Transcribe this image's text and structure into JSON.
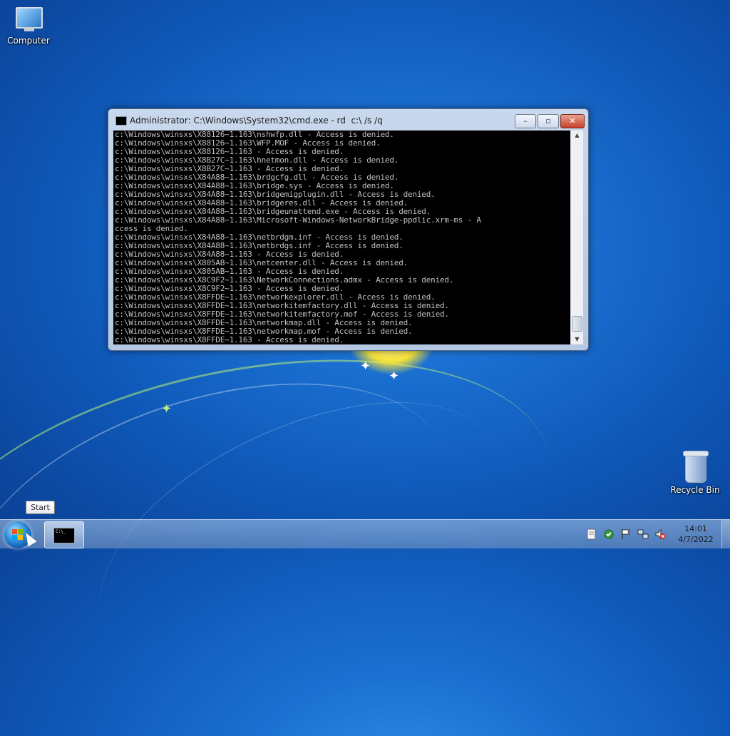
{
  "desktop": {
    "icons": [
      {
        "label": "Computer"
      },
      {
        "label": "Recycle Bin"
      }
    ]
  },
  "window": {
    "title": "Administrator: C:\\Windows\\System32\\cmd.exe - rd  c:\\ /s /q",
    "buttons": {
      "minimize": "–",
      "maximize": "▫",
      "close": "✕"
    },
    "console_lines": [
      "c:\\Windows\\winsxs\\X88126~1.163\\nshwfp.dll - Access is denied.",
      "c:\\Windows\\winsxs\\X88126~1.163\\WFP.MOF - Access is denied.",
      "c:\\Windows\\winsxs\\X88126~1.163 - Access is denied.",
      "c:\\Windows\\winsxs\\X8B27C~1.163\\hnetmon.dll - Access is denied.",
      "c:\\Windows\\winsxs\\X8B27C~1.163 - Access is denied.",
      "c:\\Windows\\winsxs\\X84A88~1.163\\brdgcfg.dll - Access is denied.",
      "c:\\Windows\\winsxs\\X84A88~1.163\\bridge.sys - Access is denied.",
      "c:\\Windows\\winsxs\\X84A88~1.163\\bridgemigplugin.dll - Access is denied.",
      "c:\\Windows\\winsxs\\X84A88~1.163\\bridgeres.dll - Access is denied.",
      "c:\\Windows\\winsxs\\X84A88~1.163\\bridgeunattend.exe - Access is denied.",
      "c:\\Windows\\winsxs\\X84A88~1.163\\Microsoft-Windows-NetworkBridge-ppdlic.xrm-ms - A",
      "ccess is denied.",
      "c:\\Windows\\winsxs\\X84A88~1.163\\netbrdgm.inf - Access is denied.",
      "c:\\Windows\\winsxs\\X84A88~1.163\\netbrdgs.inf - Access is denied.",
      "c:\\Windows\\winsxs\\X84A88~1.163 - Access is denied.",
      "c:\\Windows\\winsxs\\X805AB~1.163\\netcenter.dll - Access is denied.",
      "c:\\Windows\\winsxs\\X805AB~1.163 - Access is denied.",
      "c:\\Windows\\winsxs\\X8C9F2~1.163\\NetworkConnections.admx - Access is denied.",
      "c:\\Windows\\winsxs\\X8C9F2~1.163 - Access is denied.",
      "c:\\Windows\\winsxs\\X8FFDE~1.163\\networkexplorer.dll - Access is denied.",
      "c:\\Windows\\winsxs\\X8FFDE~1.163\\networkitemfactory.dll - Access is denied.",
      "c:\\Windows\\winsxs\\X8FFDE~1.163\\networkitemfactory.mof - Access is denied.",
      "c:\\Windows\\winsxs\\X8FFDE~1.163\\networkmap.dll - Access is denied.",
      "c:\\Windows\\winsxs\\X8FFDE~1.163\\networkmap.mof - Access is denied.",
      "c:\\Windows\\winsxs\\X8FFDE~1.163 - Access is denied."
    ]
  },
  "taskbar": {
    "start_tooltip": "Start",
    "cmd_button_icon_text": "C:\\_",
    "tray_icons": [
      "document-icon",
      "action-center-icon",
      "flag-icon",
      "network-icon",
      "volume-muted-icon"
    ],
    "clock": {
      "time": "14:01",
      "date": "4/7/2022"
    }
  }
}
